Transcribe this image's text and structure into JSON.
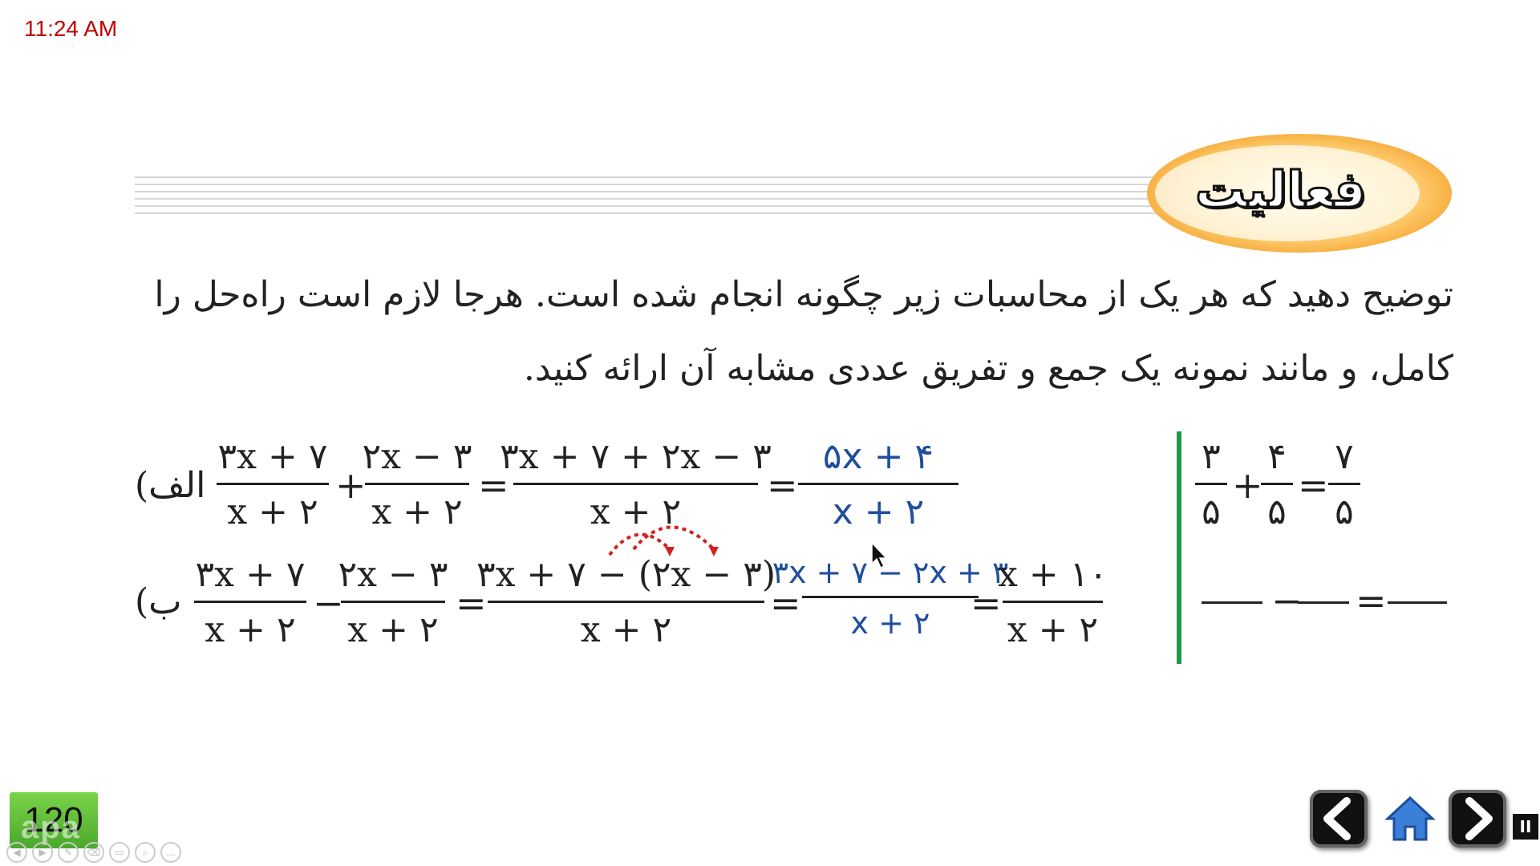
{
  "clock": "11:24 AM",
  "section_title": "فعالیت",
  "paragraph": {
    "line1": "توضیح دهید که هر یک از محاسبات زیر چگونه انجام شده است. هرجا لازم است راه‌حل را",
    "line2": "کامل، و مانند نمونه یک جمع و تفریق عددی مشابه آن ارائه کنید."
  },
  "eq_a": {
    "label": "الف)",
    "f1_num": "۳x + ۷",
    "f1_den": "x + ۲",
    "f2_num": "۲x − ۳",
    "f2_den": "x + ۲",
    "f3_num": "۳x + ۷ + ۲x − ۳",
    "f3_den": "x + ۲",
    "f4_num": "۵x + ۴",
    "f4_den": "x + ۲",
    "plus": "+",
    "eq": "="
  },
  "eq_b": {
    "label": "ب)",
    "f1_num": "۳x + ۷",
    "f1_den": "x + ۲",
    "f2_num": "۲x − ۳",
    "f2_den": "x + ۲",
    "f3_num": "۳x + ۷ − (۲x − ۳)",
    "f3_den": "x + ۲",
    "f4_num": "۳x + ۷ − ۲x + ۳",
    "f4_den": "x + ۲",
    "f5_num": "x + ۱۰",
    "f5_den": "x + ۲",
    "minus": "−",
    "eq": "="
  },
  "example": {
    "f1_num": "۳",
    "f1_den": "۵",
    "f2_num": "۴",
    "f2_den": "۵",
    "f3_num": "۷",
    "f3_den": "۵",
    "plus": "+",
    "eq": "=",
    "minus": "−"
  },
  "page_number": "120",
  "watermark": "apa",
  "colors": {
    "accent_blue": "#1f4e9c",
    "divider_green": "#1f9a4a",
    "clock_red": "#c00000",
    "arrow_red": "#d42020",
    "page_green": "#5cbc35"
  }
}
